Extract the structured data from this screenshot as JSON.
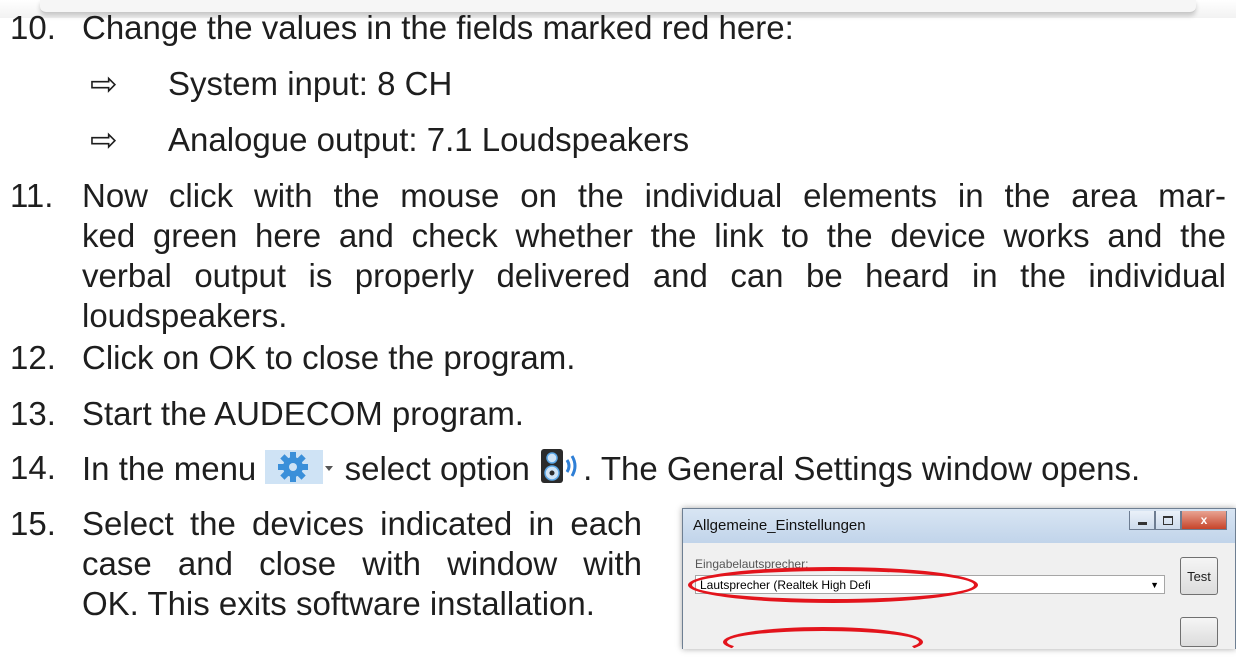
{
  "steps": {
    "s10": {
      "num": "10.",
      "text": "Change the values in the fields marked red here:"
    },
    "s10_sub1": {
      "arrow": "⇨",
      "text": "System input: 8 CH"
    },
    "s10_sub2": {
      "arrow": "⇨",
      "text": "Analogue output: 7.1 Loudspeakers"
    },
    "s11": {
      "num": "11.",
      "line1": "Now click with the mouse on the individual elements in the area mar-",
      "line2": "ked green here and check whether the link to the device works and the",
      "line3": "verbal output is properly delivered and can be heard in the individual",
      "line4": "loudspeakers."
    },
    "s12": {
      "num": "12.",
      "text": "Click on OK to close the program."
    },
    "s13": {
      "num": "13.",
      "text": "Start the AUDECOM program."
    },
    "s14": {
      "num": "14.",
      "text_a": "In the menu",
      "text_b": "select option",
      "text_c": ". The General Settings window opens."
    },
    "s15": {
      "num": "15.",
      "line1": "Select the devices indicated in each",
      "line2": "case and close with window with",
      "line3": "OK. This exits software installation."
    }
  },
  "window": {
    "title": "Allgemeine_Einstellungen",
    "field_label": "Eingabelautsprecher:",
    "combo_value": "Lautsprecher (Realtek High Defi",
    "test_button": "Test",
    "close_glyph": "x"
  },
  "colors": {
    "highlight": "#e3141c",
    "gear_icon": "#3a8fd9"
  },
  "icons": [
    "gear-icon",
    "speaker-icon"
  ]
}
